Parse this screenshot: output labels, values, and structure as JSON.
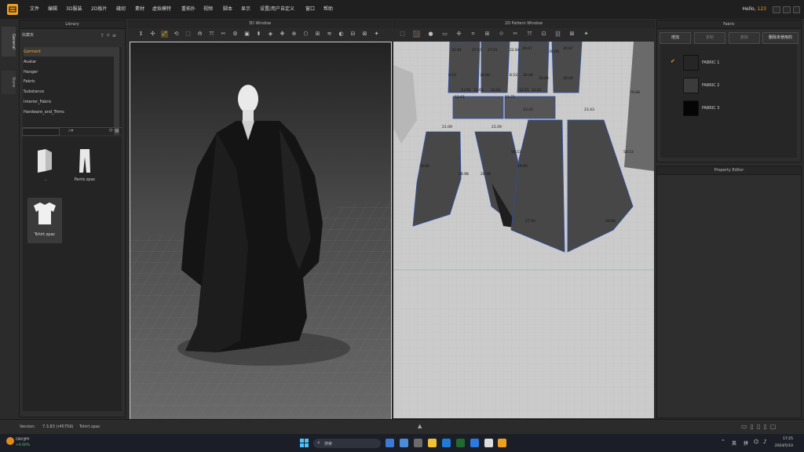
{
  "menubar": {
    "items": [
      "文件",
      "编辑",
      "3D服装",
      "2D板片",
      "缝纫",
      "素材",
      "虚拟模特",
      "重拓扑",
      "视频",
      "脚本",
      "显示",
      "设置/用户自定义",
      "窗口",
      "帮助"
    ],
    "hello_prefix": "Hello,",
    "hello_user": "123"
  },
  "sidetabs": {
    "general": "General",
    "store": "Store"
  },
  "library": {
    "title": "Library",
    "favorites_label": "收藏夹",
    "categories": [
      "Garment",
      "Avatar",
      "Hanger",
      "Fabric",
      "Substance",
      "Interior_Fabric",
      "Hardware_and_Trims"
    ],
    "files": [
      {
        "name": "..",
        "icon": "folder-icon"
      },
      {
        "name": "Pants.zpac",
        "icon": "pants-icon"
      },
      {
        "name": "Tshirt.zpac",
        "icon": "tshirt-icon"
      }
    ]
  },
  "window3d": {
    "title": "3D Window"
  },
  "pattern2d": {
    "title": "2D Pattern Window",
    "measurements": [
      "22.84",
      "27.61",
      "27.61",
      "22.84",
      "29.67",
      "30.00",
      "29.67",
      "8.53",
      "30.00",
      "8.53",
      "30.00",
      "30.00",
      "30.00",
      "11.61",
      "12.61",
      "12.61",
      "12.61",
      "11.71",
      "12.61",
      "12.61",
      "21.09",
      "21.09",
      "23.43",
      "23.43",
      "29.60",
      "28.98",
      "28.98",
      "29.60",
      "58.53",
      "58.53",
      "79.68",
      "27.50",
      "28.80"
    ]
  },
  "fabric": {
    "title": "Fabric",
    "buttons": [
      "增加",
      "复制",
      "删除",
      "删除未使用的"
    ],
    "items": [
      {
        "name": "FABRIC 1",
        "color": "#262626",
        "checked": true
      },
      {
        "name": "FABRIC 2",
        "color": "#3b3b3b",
        "checked": false
      },
      {
        "name": "FABRIC 3",
        "color": "#050505",
        "checked": false
      }
    ]
  },
  "property_editor": {
    "title": "Property Editor"
  },
  "statusbar": {
    "version_label": "Version:",
    "version": "7.3.83 (r45759)",
    "file": "Tshirt.zpac"
  },
  "taskbar": {
    "weather_currency": "CNY/JPY",
    "weather_change": "+0.60%",
    "search_placeholder": "搜索",
    "ime_lang": "英",
    "ime_mode": "拼",
    "time": "17:25",
    "date": "2024/5/10"
  },
  "colors": {
    "accent": "#f0a020",
    "menubar": "#1f1f1f",
    "panel": "#2b2b2b",
    "pattern_bg": "#c9c9c9"
  }
}
